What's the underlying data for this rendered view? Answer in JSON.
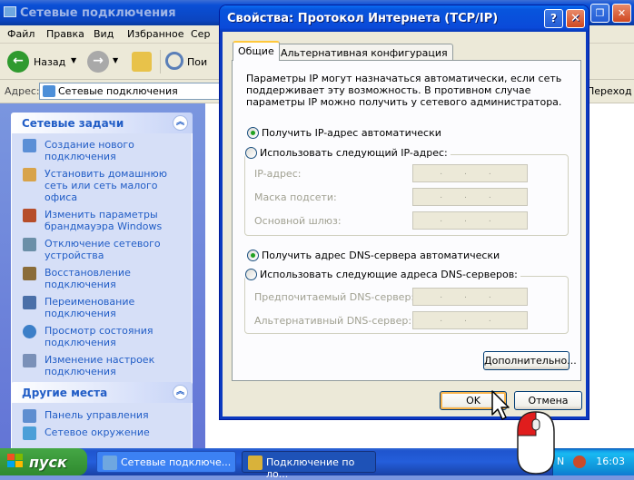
{
  "explorer": {
    "title": "Сетевые подключения",
    "menu": [
      "Файл",
      "Правка",
      "Вид",
      "Избранное",
      "Сер"
    ],
    "toolbar": {
      "back_label": "Назад",
      "search_label": "Пои"
    },
    "address_label": "Адрес:",
    "address_value": "Сетевые подключения",
    "obscured_right_text": "Переход",
    "network_tasks": {
      "header": "Сетевые задачи",
      "items": [
        "Создание нового подключения",
        "Установить домашнюю сеть или сеть малого офиса",
        "Изменить параметры брандмауэра Windows",
        "Отключение сетевого устройства",
        "Восстановление подключения",
        "Переименование подключения",
        "Просмотр состояния подключения",
        "Изменение настроек подключения"
      ]
    },
    "other_places": {
      "header": "Другие места",
      "items": [
        "Панель управления",
        "Сетевое окружение"
      ]
    }
  },
  "dialog": {
    "title": "Свойства: Протокол Интернета (TCP/IP)",
    "tabs": [
      "Общие",
      "Альтернативная конфигурация"
    ],
    "intro": "Параметры IP могут назначаться автоматически, если сеть поддерживает эту возможность. В противном случае параметры IP можно получить у сетевого администратора.",
    "radio_auto_ip": "Получить IP-адрес автоматически",
    "radio_manual_ip": "Использовать следующий IP-адрес:",
    "ip_address_label": "IP-адрес:",
    "subnet_label": "Маска подсети:",
    "gateway_label": "Основной шлюз:",
    "radio_auto_dns": "Получить адрес DNS-сервера автоматически",
    "radio_manual_dns": "Использовать следующие адреса DNS-серверов:",
    "preferred_dns_label": "Предпочитаемый DNS-сервер:",
    "alternate_dns_label": "Альтернативный DNS-сервер:",
    "ip_field_dots": "...",
    "advanced_button": "Дополнительно...",
    "ok_button": "OK",
    "cancel_button": "Отмена",
    "selected_ip_mode": "auto",
    "selected_dns_mode": "auto"
  },
  "taskbar": {
    "start_label": "пуск",
    "tasks": [
      "Сетевые подключе...",
      "Подключение по ло..."
    ],
    "clock": "16:03"
  },
  "colors": {
    "xp_blue": "#0a4ad9",
    "task_link": "#215dc6",
    "start_green": "#3c9b3c",
    "radio_dot": "#21a121"
  }
}
